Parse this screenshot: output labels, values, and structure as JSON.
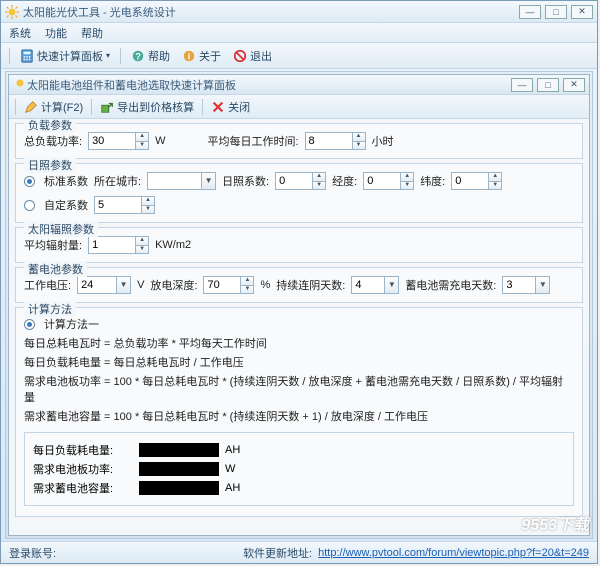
{
  "outer": {
    "title": "太阳能光伏工具 - 光电系统设计",
    "menu": {
      "system": "系统",
      "function": "功能",
      "help": "帮助"
    },
    "tools": {
      "quick_panel": "快速计算面板",
      "help": "帮助",
      "about": "关于",
      "exit": "退出"
    }
  },
  "inner": {
    "title": "太阳能电池组件和蓄电池选取快速计算面板",
    "btn_calc": "计算(F2)",
    "btn_export": "导出到价格核算",
    "btn_close": "关闭"
  },
  "load": {
    "group": "负载参数",
    "total_power_label": "总负载功率:",
    "total_power": "30",
    "unit_w": "W",
    "avg_hours_label": "平均每日工作时间:",
    "avg_hours": "8",
    "unit_hour": "小时"
  },
  "sun": {
    "group": "日照参数",
    "std_coef": "标准系数",
    "city_label": "所在城市:",
    "sun_coef_label": "日照系数:",
    "sun_coef": "0",
    "lon_label": "经度:",
    "lon": "0",
    "lat_label": "纬度:",
    "lat": "0",
    "custom_coef": "自定系数",
    "custom_val": "5"
  },
  "irr": {
    "group": "太阳辐照参数",
    "avg_label": "平均辐射量:",
    "avg_val": "1",
    "unit": "KW/m2"
  },
  "bat": {
    "group": "蓄电池参数",
    "voltage_label": "工作电压:",
    "voltage": "24",
    "unit_v": "V",
    "dod_label": "放电深度:",
    "dod": "70",
    "unit_pct": "%",
    "cloudy_label": "持续连阴天数:",
    "cloudy": "4",
    "charge_label": "蓄电池需充电天数:",
    "charge": "3"
  },
  "method": {
    "group": "计算方法",
    "m1": "计算方法一",
    "f1": "每日总耗电瓦时 = 总负载功率 * 平均每天工作时间",
    "f2": "每日负载耗电量 = 每日总耗电瓦时 / 工作电压",
    "f3": "需求电池板功率 = 100 * 每日总耗电瓦时 * (持续连阴天数 / 放电深度 + 蓄电池需充电天数 / 日照系数) / 平均辐射量",
    "f4": "需求蓄电池容量 = 100 * 每日总耗电瓦时 * (持续连阴天数 + 1) / 放电深度 / 工作电压",
    "r1_label": "每日负载耗电量:",
    "r1_unit": "AH",
    "r2_label": "需求电池板功率:",
    "r2_unit": "W",
    "r3_label": "需求蓄电池容量:",
    "r3_unit": "AH"
  },
  "status": {
    "login_label": "登录账号:",
    "update_label": "软件更新地址:",
    "update_url": "http://www.pvtool.com/forum/viewtopic.php?f=20&t=249"
  },
  "watermark": "9553下载"
}
